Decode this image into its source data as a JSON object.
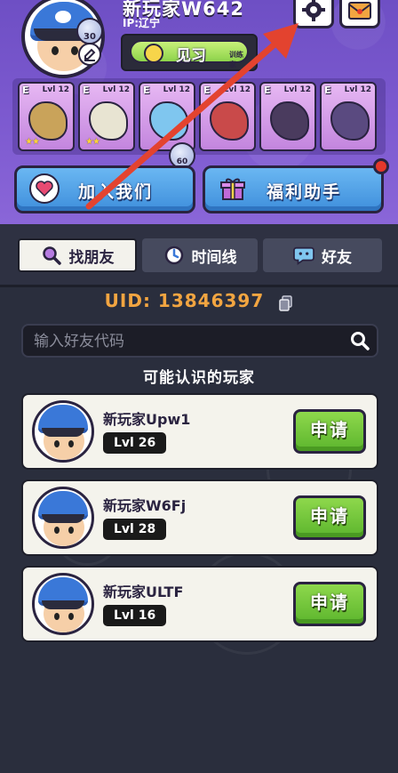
{
  "profile": {
    "name": "新玩家W642",
    "ip": "IP:辽宁",
    "avatar_level": "30",
    "title_main": "见习",
    "title_sub": "训练家"
  },
  "team": [
    {
      "rank": "E",
      "level": "Lvl 12",
      "color": "#c9a35a",
      "stars": "★★"
    },
    {
      "rank": "E",
      "level": "Lvl 12",
      "color": "#e8e4d2",
      "stars": "★★"
    },
    {
      "rank": "E",
      "level": "Lvl 12",
      "color": "#7fc6ef",
      "stars": ""
    },
    {
      "rank": "E",
      "level": "Lvl 12",
      "color": "#c94a4a",
      "stars": ""
    },
    {
      "rank": "E",
      "level": "Lvl 12",
      "color": "#4a3b5e",
      "stars": ""
    },
    {
      "rank": "E",
      "level": "Lvl 12",
      "color": "#5a4a80",
      "stars": ""
    }
  ],
  "team_bubble": "60",
  "buttons": {
    "join": "加入我们",
    "welfare": "福利助手"
  },
  "tabs": [
    {
      "label": "找朋友",
      "icon": "magnifier-icon"
    },
    {
      "label": "时间线",
      "icon": "clock-icon"
    },
    {
      "label": "好友",
      "icon": "chat-icon"
    }
  ],
  "uid": "UID: 13846397",
  "search": {
    "placeholder": "输入好友代码"
  },
  "suggest_title": "可能认识的玩家",
  "players": [
    {
      "name": "新玩家Upw1",
      "level": "Lvl 26",
      "action": "申请"
    },
    {
      "name": "新玩家W6Fj",
      "level": "Lvl 28",
      "action": "申请"
    },
    {
      "name": "新玩家ULTF",
      "level": "Lvl 16",
      "action": "申请"
    }
  ],
  "colors": {
    "header_purple": "#7d5ad0",
    "uid_orange": "#f2a541",
    "apply_green": "#6cc23a",
    "arrow_red": "#e3432f",
    "page_bg": "#2a2e3d"
  }
}
